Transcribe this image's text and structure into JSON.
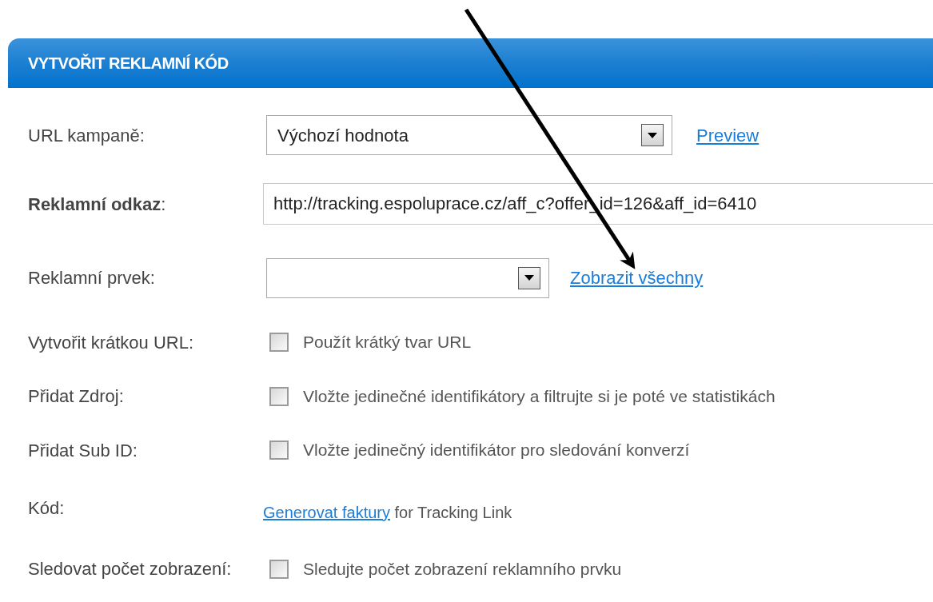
{
  "panel": {
    "title": "VYTVOŘIT REKLAMNÍ KÓD"
  },
  "rows": [
    {
      "kind": "select",
      "label": "URL kampaně:",
      "value": "Výchozí hodnota",
      "link": "Preview"
    },
    {
      "kind": "input",
      "label": "**Reklamní odkaz**:",
      "value": "http://tracking.espoluprace.cz/aff_c?offer_id=126&aff_id=6410"
    },
    {
      "kind": "select",
      "label": "Reklamní prvek:",
      "link": "Zobrazit všechny"
    },
    {
      "kind": "checkbox",
      "label": "Vytvořit krátkou URL:",
      "text": "Použít krátký tvar URL",
      "checked": false
    },
    {
      "kind": "checkbox",
      "label": "Přidat Zdroj:",
      "text": "Vložte jedinečné identifikátory a filtrujte si je poté ve statistikách",
      "checked": false
    },
    {
      "kind": "checkbox",
      "label": "Přidat Sub ID:",
      "text": "Vložte jedinečný identifikátor pro sledování konverzí",
      "checked": false
    },
    {
      "kind": "link_text",
      "label": "Kód:",
      "link": "Generovat faktury",
      "text": " for Tracking Link"
    },
    {
      "kind": "checkbox",
      "label": "Sledovat počet zobrazení:",
      "text": "Sledujte počet zobrazení reklamního prvku",
      "checked": false
    }
  ]
}
